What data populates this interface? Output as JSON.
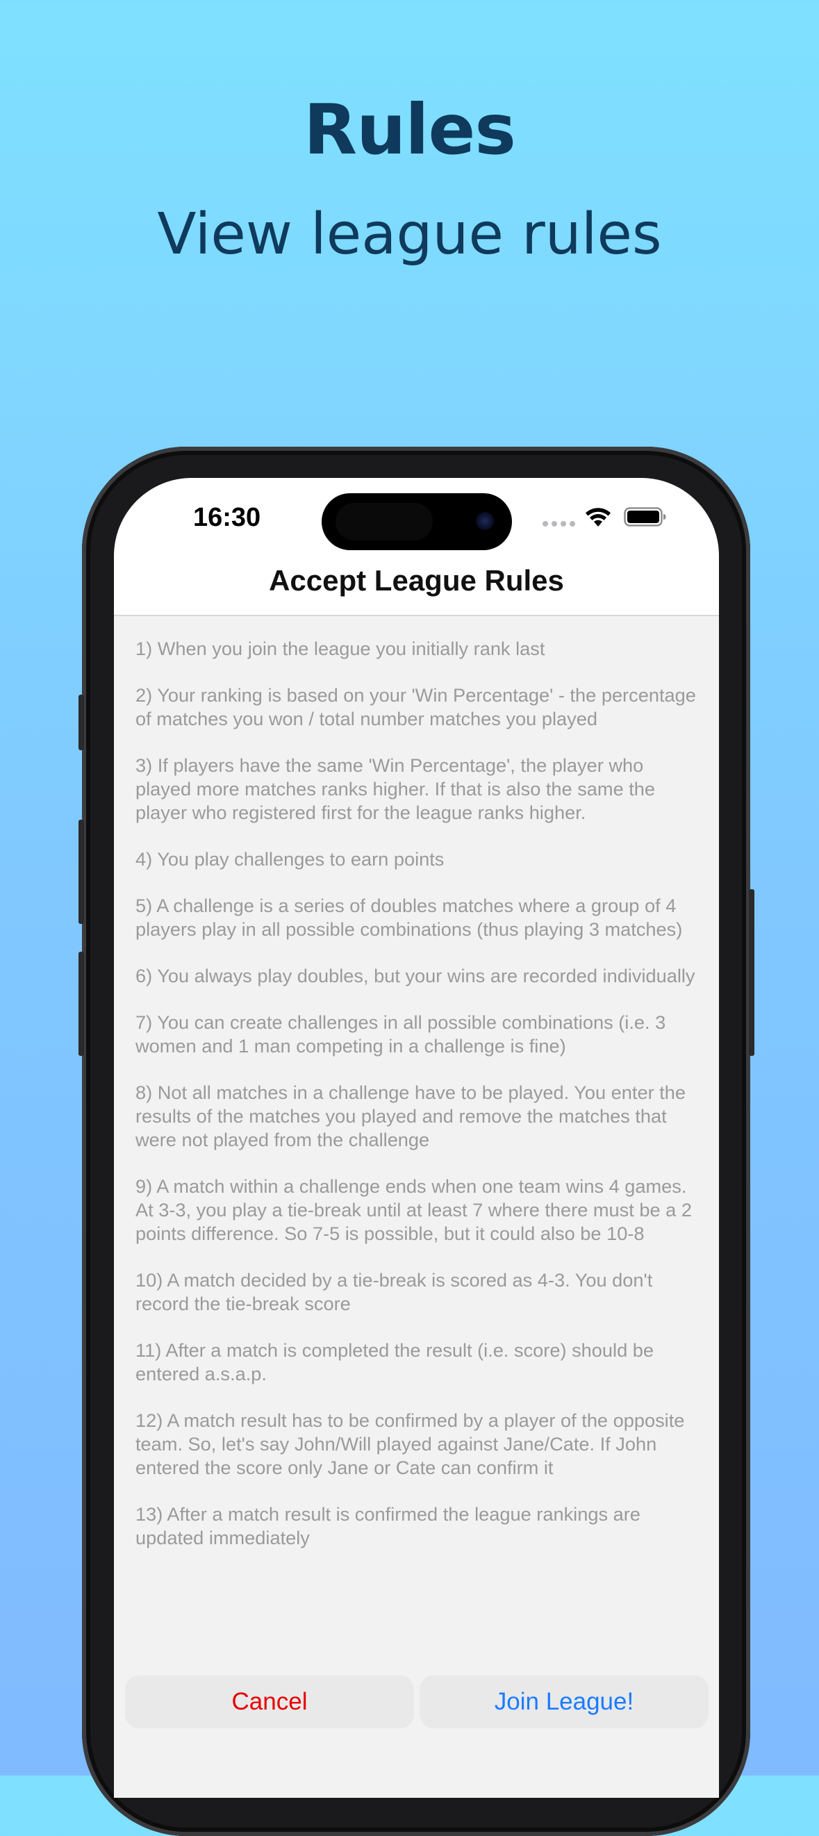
{
  "hero": {
    "title": "Rules",
    "subtitle": "View league rules"
  },
  "status_bar": {
    "time": "16:30",
    "icons": [
      "signal-dots-icon",
      "wifi-icon",
      "battery-icon"
    ]
  },
  "nav": {
    "title": "Accept League Rules"
  },
  "rules": [
    "1) When you join the league you initially rank last",
    "2) Your ranking is based on your 'Win Percentage' - the percentage of matches you won / total number matches you played",
    "3) If players have the same 'Win Percentage', the player who played more matches ranks higher. If that is also the same the player who registered first for the league ranks higher.",
    "4) You play challenges to earn points",
    "5) A challenge is a series of doubles matches where a group of 4 players play in all possible combinations (thus playing 3 matches)",
    "6) You always play doubles, but your wins are recorded individually",
    "7) You can create challenges in all possible combinations (i.e. 3 women and 1 man competing in a challenge is fine)",
    "8) Not all matches in a challenge have to be played. You enter the results of the matches you played and remove the matches that were not played from the challenge",
    "9) A match within a challenge ends when one team wins 4 games. At 3-3, you play a tie-break until at least 7 where there must be a 2 points difference. So 7-5 is possible, but it could also be 10-8",
    "10) A match decided by a tie-break is scored as 4-3. You don't record the tie-break score",
    "11) After a match is completed the result (i.e. score) should be entered a.s.a.p.",
    "12) A match result has to be confirmed by a player of the opposite team. So, let's say John/Will played against Jane/Cate. If John entered the score only Jane or Cate can confirm it",
    "13) After a match result is confirmed the league rankings are updated immediately"
  ],
  "buttons": {
    "cancel": "Cancel",
    "join": "Join League!"
  },
  "colors": {
    "background_top": "#7fe1ff",
    "background_bottom": "#80baff",
    "heading": "#0f3a5c",
    "rule_text": "#9a9a9a",
    "cancel": "#e60000",
    "join": "#1a7cff"
  }
}
